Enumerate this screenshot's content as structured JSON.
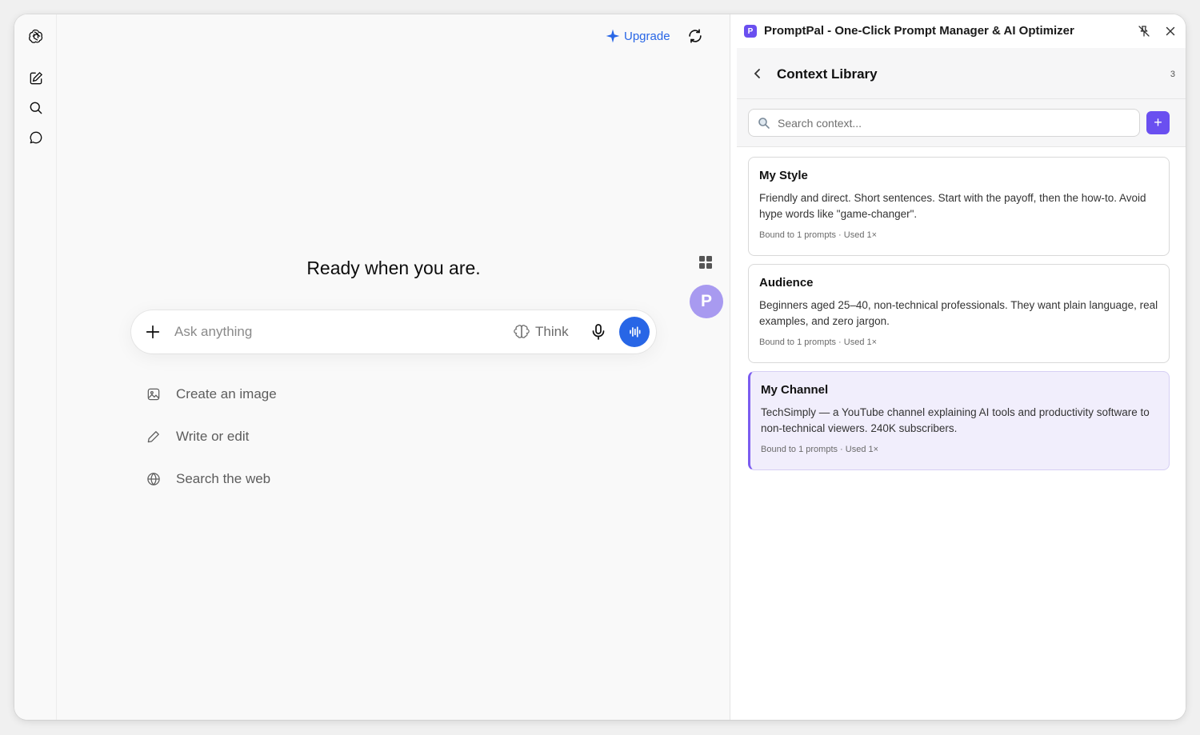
{
  "main": {
    "upgrade_label": "Upgrade",
    "hero": "Ready when you are.",
    "composer": {
      "placeholder": "Ask anything",
      "think_label": "Think"
    },
    "suggestions": [
      {
        "label": "Create an image",
        "icon": "image-icon"
      },
      {
        "label": "Write or edit",
        "icon": "pencil-icon"
      },
      {
        "label": "Search the web",
        "icon": "globe-icon"
      }
    ],
    "floating_avatar": "P"
  },
  "panel": {
    "logo_letter": "P",
    "title": "PromptPal - One-Click Prompt Manager & AI Optimizer",
    "library_title": "Context Library",
    "library_count": "3",
    "search_placeholder": "Search context...",
    "add_label": "+",
    "cards": [
      {
        "title": "My Style",
        "body": "Friendly and direct. Short sentences. Start with the payoff, then the how-to. Avoid hype words like \"game-changer\".",
        "meta": "Bound to 1 prompts · Used 1×"
      },
      {
        "title": "Audience",
        "body": "Beginners aged 25–40, non-technical professionals. They want plain language, real examples, and zero jargon.",
        "meta": "Bound to 1 prompts · Used 1×"
      },
      {
        "title": "My Channel",
        "body": "TechSimply — a YouTube channel explaining AI tools and productivity software to non-technical viewers. 240K subscribers.",
        "meta": "Bound to 1 prompts · Used 1×"
      }
    ]
  },
  "colors": {
    "accent_blue": "#2866e6",
    "accent_purple": "#6a4ff0",
    "active_card_bg": "#f1eefc"
  }
}
